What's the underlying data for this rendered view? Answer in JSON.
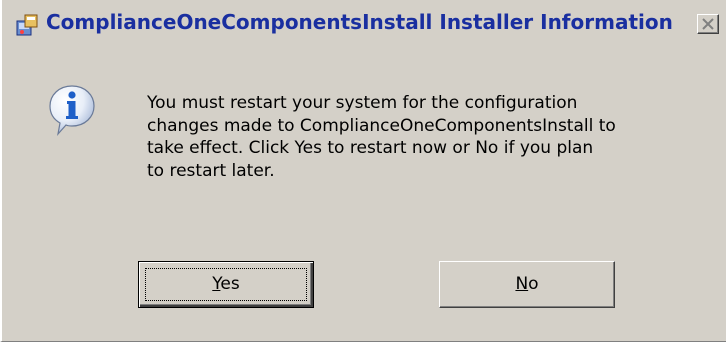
{
  "window": {
    "title": "ComplianceOneComponentsInstall Installer Information",
    "close_icon": "close-x-icon",
    "app_icon": "installer-icon"
  },
  "dialog": {
    "icon": "information-icon",
    "message_lines": [
      "You must restart your system for the configuration",
      "changes made to ComplianceOneComponentsInstall to",
      "take effect. Click Yes to restart now or No if you plan",
      "to restart later."
    ]
  },
  "buttons": {
    "yes": {
      "accel": "Y",
      "rest": "es"
    },
    "no": {
      "accel": "N",
      "rest": "o"
    }
  },
  "colors": {
    "title_text": "#1a2fa0",
    "face": "#d4d0c8",
    "info_blue": "#1e5fc8"
  }
}
